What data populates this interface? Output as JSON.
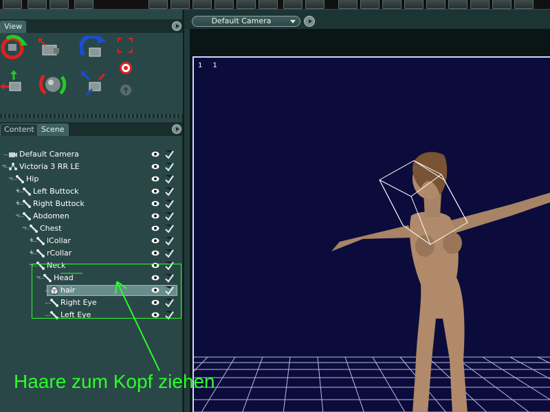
{
  "left_panel": {
    "view_tab": "View",
    "content_tab": "Content",
    "scene_tab": "Scene"
  },
  "viewport": {
    "camera_label": "Default Camera",
    "coords": "1 1"
  },
  "scene_tree": [
    {
      "label": "Default Camera",
      "icon": "camera-icon",
      "depth": 0
    },
    {
      "label": "Victoria 3 RR LE",
      "icon": "figure-icon",
      "depth": 0
    },
    {
      "label": "Hip",
      "icon": "bone-icon",
      "depth": 1
    },
    {
      "label": "Left Buttock",
      "icon": "bone-icon",
      "depth": 2
    },
    {
      "label": "Right Buttock",
      "icon": "bone-icon",
      "depth": 2
    },
    {
      "label": "Abdomen",
      "icon": "bone-icon",
      "depth": 2
    },
    {
      "label": "Chest",
      "icon": "bone-icon",
      "depth": 3
    },
    {
      "label": "lCollar",
      "icon": "bone-icon",
      "depth": 4
    },
    {
      "label": "rCollar",
      "icon": "bone-icon",
      "depth": 4
    },
    {
      "label": "Neck",
      "icon": "bone-icon",
      "depth": 4
    },
    {
      "label": "Head",
      "icon": "bone-icon",
      "depth": 5
    },
    {
      "label": "hair",
      "icon": "prop-icon",
      "depth": 6,
      "selected": true
    },
    {
      "label": "Right Eye",
      "icon": "bone-icon",
      "depth": 6
    },
    {
      "label": "Left Eye",
      "icon": "bone-icon",
      "depth": 6
    }
  ],
  "annotation": {
    "text": "Haare zum Kopf ziehen",
    "color": "#2bff2b"
  }
}
